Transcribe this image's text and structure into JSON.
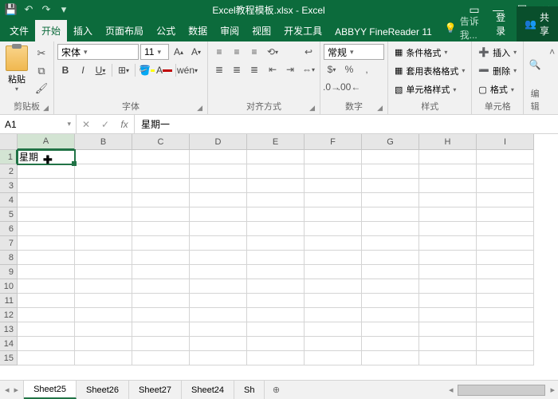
{
  "title": "Excel教程模板.xlsx - Excel",
  "tabs": {
    "file": "文件",
    "home": "开始",
    "insert": "插入",
    "pagelayout": "页面布局",
    "formulas": "公式",
    "data": "数据",
    "review": "审阅",
    "view": "视图",
    "developer": "开发工具",
    "abbyy": "ABBYY FineReader 11",
    "tellme_placeholder": "告诉我...",
    "login": "登录",
    "share": "共享"
  },
  "ribbon": {
    "clipboard": {
      "label": "剪贴板",
      "paste": "粘贴"
    },
    "font": {
      "label": "字体",
      "name": "宋体",
      "size": "11",
      "ruby": "wén"
    },
    "alignment": {
      "label": "对齐方式"
    },
    "number": {
      "label": "数字",
      "format": "常规"
    },
    "styles": {
      "label": "样式",
      "conditional": "条件格式",
      "table": "套用表格格式",
      "cellstyles": "单元格样式"
    },
    "cells": {
      "label": "单元格",
      "insert": "插入",
      "delete": "删除",
      "format": "格式"
    },
    "editing": {
      "label": "编辑"
    }
  },
  "namebox": "A1",
  "formula": "星期一",
  "columns": [
    "A",
    "B",
    "C",
    "D",
    "E",
    "F",
    "G",
    "H",
    "I"
  ],
  "rows": [
    "1",
    "2",
    "3",
    "4",
    "5",
    "6",
    "7",
    "8",
    "9",
    "10",
    "11",
    "12",
    "13",
    "14",
    "15"
  ],
  "active_cell": {
    "row": 0,
    "col": 0,
    "value": "星期"
  },
  "sheets": {
    "tabs": [
      "Sheet25",
      "Sheet26",
      "Sheet27",
      "Sheet24",
      "Sh"
    ],
    "active": 0
  }
}
